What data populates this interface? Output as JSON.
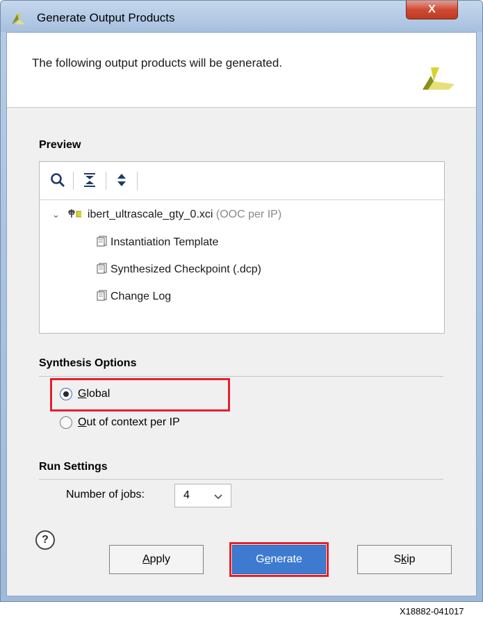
{
  "window": {
    "title": "Generate Output Products",
    "close_label": "X"
  },
  "header": {
    "message": "The following output products will be generated."
  },
  "preview": {
    "title": "Preview",
    "toolbar": [
      "search-icon",
      "collapse-all-icon",
      "expand-all-icon"
    ],
    "root": {
      "name": "ibert_ultrascale_gty_0.xci",
      "note": "(OOC per IP)"
    },
    "items": [
      {
        "label": "Instantiation Template"
      },
      {
        "label": "Synthesized Checkpoint (.dcp)"
      },
      {
        "label": "Change Log"
      }
    ]
  },
  "synthesis": {
    "title": "Synthesis Options",
    "options": [
      {
        "mnemonic": "G",
        "rest": "lobal",
        "checked": true
      },
      {
        "mnemonic": "O",
        "rest": "ut of context per IP",
        "checked": false
      }
    ]
  },
  "run_settings": {
    "title": "Run Settings",
    "jobs_label_pre": "Number of ",
    "jobs_label_mnemonic": "j",
    "jobs_label_post": "obs:",
    "jobs_value": "4"
  },
  "buttons": {
    "help": "?",
    "apply_mnemonic": "A",
    "apply_rest": "pply",
    "generate_pre": "G",
    "generate_mnemonic": "e",
    "generate_post": "nerate",
    "skip_pre": "S",
    "skip_mnemonic": "k",
    "skip_post": "ip"
  },
  "footer": {
    "code": "X18882-041017"
  },
  "colors": {
    "highlight_frame": "#e5202f",
    "primary_button": "#3e7bd0",
    "brand_yellow": "#d9d231"
  }
}
